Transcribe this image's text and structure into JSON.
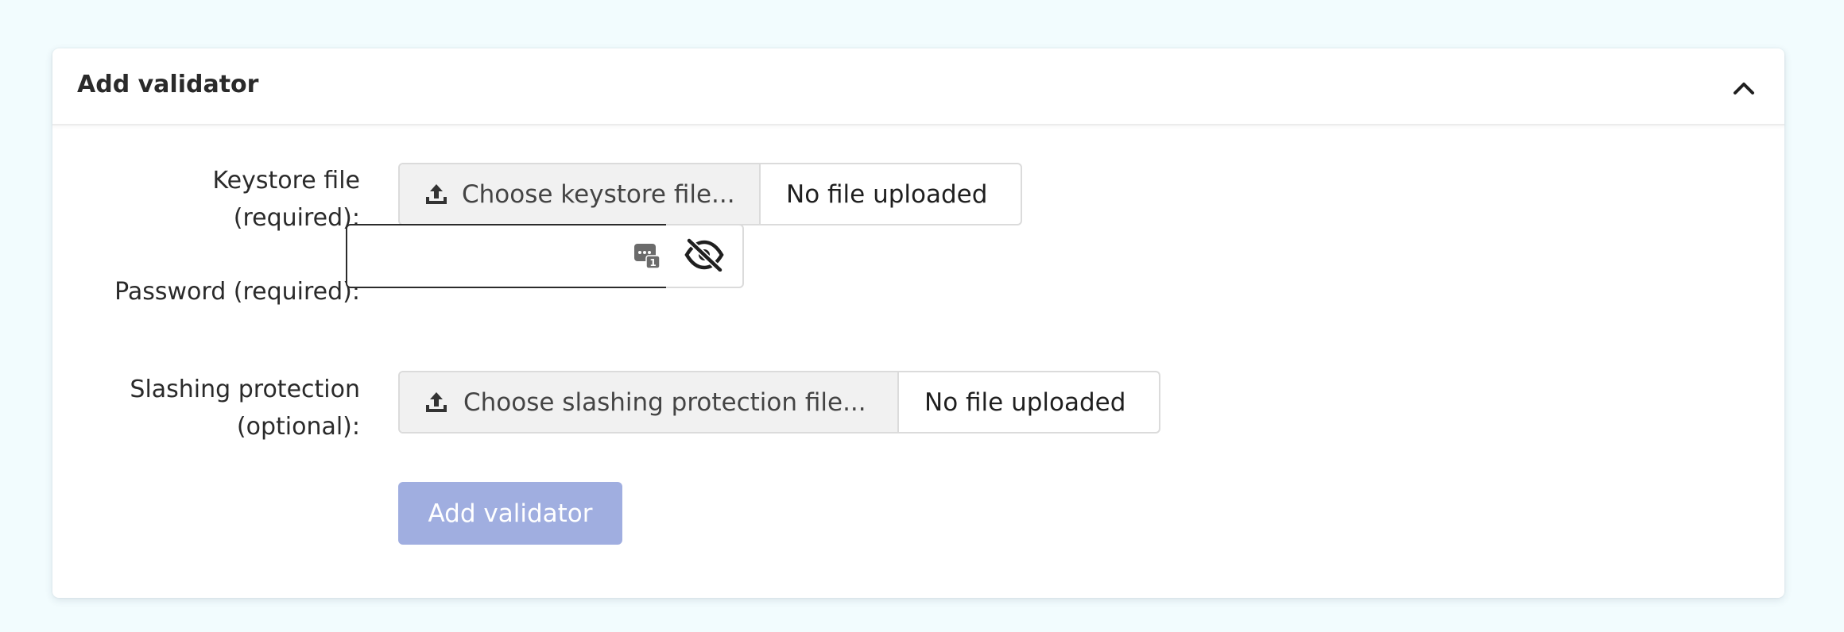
{
  "panel": {
    "title": "Add validator",
    "collapse_icon": "chevron-up-icon"
  },
  "form": {
    "keystore": {
      "label_line1": "Keystore file",
      "label_line2": "(required):",
      "choose_label": "Choose keystore file...",
      "status": "No file uploaded",
      "icon": "upload-icon"
    },
    "password": {
      "label": "Password (required):",
      "value": "",
      "manager_icon": "password-manager-icon",
      "toggle_icon": "eye-slash-icon"
    },
    "slashing": {
      "label_line1": "Slashing protection",
      "label_line2": "(optional):",
      "choose_label": "Choose slashing protection file...",
      "status": "No file uploaded",
      "icon": "upload-icon"
    },
    "submit_label": "Add validator",
    "submit_enabled": false
  },
  "colors": {
    "page_background": "#f2fcfe",
    "submit_disabled": "#a0aee0",
    "choose_background": "#f1f1f1"
  }
}
